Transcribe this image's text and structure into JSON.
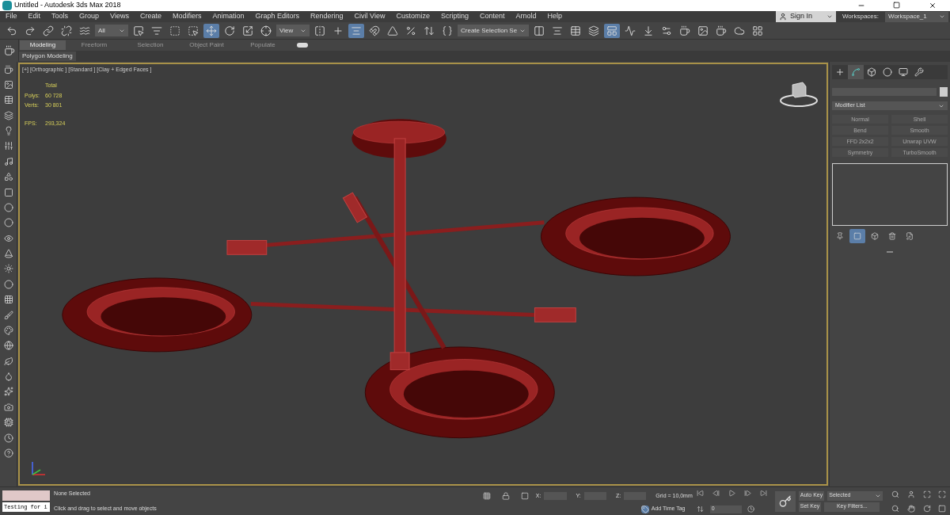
{
  "window": {
    "title": "Untitled - Autodesk 3ds Max 2018"
  },
  "menu": [
    "File",
    "Edit",
    "Tools",
    "Group",
    "Views",
    "Create",
    "Modifiers",
    "Animation",
    "Graph Editors",
    "Rendering",
    "Civil View",
    "Customize",
    "Scripting",
    "Content",
    "Arnold",
    "Help"
  ],
  "account": {
    "label": "Sign In"
  },
  "workspaces": {
    "label": "Workspaces:",
    "value": "Workspace_1"
  },
  "toolbar": {
    "selection_filter": "All",
    "reference_coord": "View",
    "named_selection": "Create Selection Se"
  },
  "ribbon": {
    "tabs": [
      {
        "label": "Modeling",
        "selected": true
      },
      {
        "label": "Freeform",
        "selected": false
      },
      {
        "label": "Selection",
        "selected": false
      },
      {
        "label": "Object Paint",
        "selected": false
      },
      {
        "label": "Populate",
        "selected": false
      }
    ],
    "panel": "Polygon Modeling"
  },
  "viewport": {
    "label": "[+] [Orthographic ] [Standard ] [Clay + Edged Faces ]",
    "stats_header": "Total",
    "stats": [
      {
        "label": "Polys:",
        "value": "60 728"
      },
      {
        "label": "Verts:",
        "value": "30 801"
      }
    ],
    "fps_label": "FPS:",
    "fps_value": "293,324"
  },
  "command_panel": {
    "tabs": [
      {
        "selected": false
      },
      {
        "selected": true
      },
      {
        "selected": false
      },
      {
        "selected": false
      },
      {
        "selected": false
      },
      {
        "selected": false
      }
    ],
    "modifier_list": "Modifier List",
    "modifier_buttons": [
      {
        "label": "Normal",
        "disabled": true
      },
      {
        "label": "Shell",
        "disabled": true
      },
      {
        "label": "Bend",
        "disabled": true
      },
      {
        "label": "Smooth",
        "disabled": true
      },
      {
        "label": "FFD 2x2x2",
        "disabled": true
      },
      {
        "label": "Unwrap UVW",
        "disabled": true
      },
      {
        "label": "Symmetry",
        "disabled": true
      },
      {
        "label": "TurboSmooth",
        "disabled": true
      }
    ]
  },
  "status": {
    "maxscript": "Testing for i",
    "selection": "None Selected",
    "prompt": "Click and drag to select and move objects",
    "x_label": "X:",
    "y_label": "Y:",
    "z_label": "Z:",
    "grid": "Grid = 10,0mm",
    "add_time_tag": "Add Time Tag",
    "frame": "0",
    "auto_key": "Auto Key",
    "set_key": "Set Key",
    "key_mode": "Selected",
    "key_filters": "Key Filters..."
  }
}
